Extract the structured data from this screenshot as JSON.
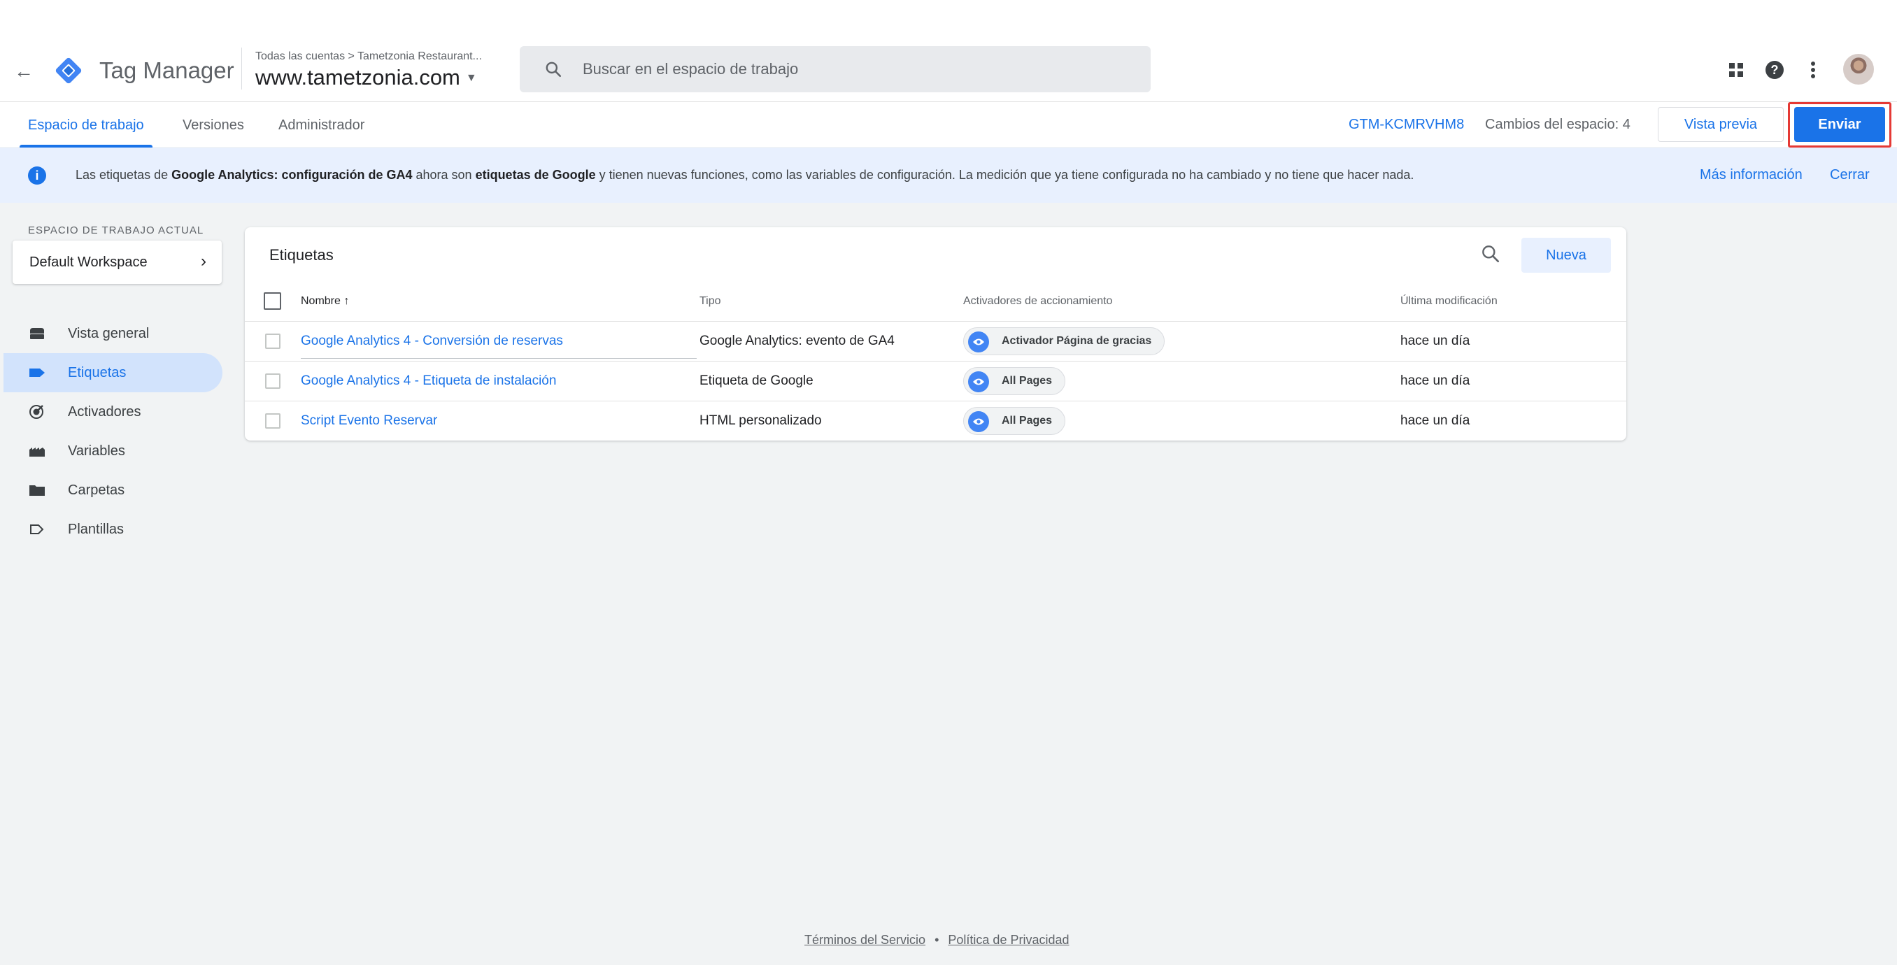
{
  "header": {
    "app_title": "Tag Manager",
    "account_path": "Todas las cuentas > Tametzonia Restaurant...",
    "container_name": "www.tametzonia.com",
    "search_placeholder": "Buscar en el espacio de trabajo"
  },
  "subnav": {
    "tabs": [
      {
        "label": "Espacio de trabajo",
        "active": true
      },
      {
        "label": "Versiones",
        "active": false
      },
      {
        "label": "Administrador",
        "active": false
      }
    ],
    "container_id": "GTM-KCMRVHM8",
    "workspace_changes": "Cambios del espacio: 4",
    "preview_label": "Vista previa",
    "submit_label": "Enviar"
  },
  "banner": {
    "text_before": "Las etiquetas de ",
    "bold_1": "Google Analytics: configuración de GA4",
    "text_middle": " ahora son ",
    "bold_2": "etiquetas de Google",
    "text_after": " y tienen nuevas funciones, como las variables de configuración. La medición que ya tiene configurada no ha cambiado y no tiene que hacer nada.",
    "more_info": "Más información",
    "close": "Cerrar"
  },
  "sidebar": {
    "workspace_label": "ESPACIO DE TRABAJO ACTUAL",
    "workspace_name": "Default Workspace",
    "items": [
      {
        "label": "Vista general",
        "icon": "overview-icon",
        "active": false
      },
      {
        "label": "Etiquetas",
        "icon": "tag-icon",
        "active": true
      },
      {
        "label": "Activadores",
        "icon": "trigger-icon",
        "active": false
      },
      {
        "label": "Variables",
        "icon": "variables-icon",
        "active": false
      },
      {
        "label": "Carpetas",
        "icon": "folder-icon",
        "active": false
      },
      {
        "label": "Plantillas",
        "icon": "template-icon",
        "active": false
      }
    ]
  },
  "tags": {
    "title": "Etiquetas",
    "new_label": "Nueva",
    "columns": {
      "name": "Nombre ↑",
      "type": "Tipo",
      "triggers": "Activadores de accionamiento",
      "modified": "Última modificación"
    },
    "rows": [
      {
        "name": "Google Analytics 4 - Conversión de reservas",
        "type": "Google Analytics: evento de GA4",
        "trigger": "Activador Página de gracias",
        "modified": "hace un día"
      },
      {
        "name": "Google Analytics 4 - Etiqueta de instalación",
        "type": "Etiqueta de Google",
        "trigger": "All Pages",
        "modified": "hace un día"
      },
      {
        "name": "Script Evento Reservar",
        "type": "HTML personalizado",
        "trigger": "All Pages",
        "modified": "hace un día"
      }
    ]
  },
  "footer": {
    "terms": "Términos del Servicio",
    "separator": "•",
    "privacy": "Política de Privacidad"
  },
  "colors": {
    "accent": "#1a73e8",
    "banner_bg": "#e8f0fe",
    "highlight_frame": "#e53935"
  }
}
